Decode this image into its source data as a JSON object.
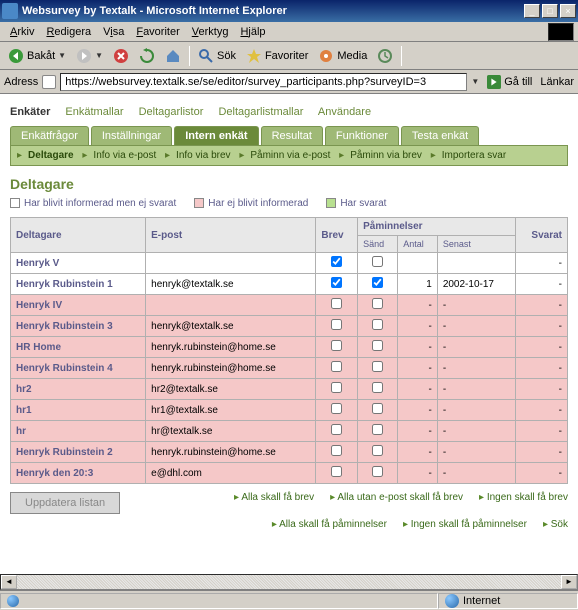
{
  "window": {
    "title": "Websurvey by Textalk - Microsoft Internet Explorer"
  },
  "menu": {
    "arkiv": "Arkiv",
    "redigera": "Redigera",
    "visa": "Visa",
    "favoriter": "Favoriter",
    "verktyg": "Verktyg",
    "hjalp": "Hjälp"
  },
  "toolbar": {
    "bakat": "Bakåt",
    "sok": "Sök",
    "favoriter": "Favoriter",
    "media": "Media"
  },
  "address": {
    "label": "Adress",
    "url": "https://websurvey.textalk.se/se/editor/survey_participants.php?surveyID=3",
    "go": "Gå till",
    "links": "Länkar"
  },
  "topnav": {
    "enkater": "Enkäter",
    "enkatmallar": "Enkätmallar",
    "deltagarlistor": "Deltagarlistor",
    "deltagarlistmallar": "Deltagarlistmallar",
    "anvandare": "Användare"
  },
  "tabs": {
    "enkatfragor": "Enkätfrågor",
    "installningar": "Inställningar",
    "intern": "Intern enkät",
    "resultat": "Resultat",
    "funktioner": "Funktioner",
    "testa": "Testa enkät"
  },
  "subnav": {
    "deltagare": "Deltagare",
    "info_epost": "Info via e-post",
    "info_brev": "Info via brev",
    "paminn_epost": "Påminn via e-post",
    "paminn_brev": "Påminn via brev",
    "importera": "Importera svar"
  },
  "section": {
    "title": "Deltagare"
  },
  "legend": {
    "informerad_ej_svarat": "Har blivit informerad men ej svarat",
    "ej_informerad": "Har ej blivit informerad",
    "har_svarat": "Har svarat"
  },
  "table": {
    "headers": {
      "deltagare": "Deltagare",
      "epost": "E-post",
      "brev": "Brev",
      "paminnelser": "Påminnelser",
      "sand": "Sänd",
      "antal": "Antal",
      "senast": "Senast",
      "svarat": "Svarat"
    },
    "rows": [
      {
        "name": "Henryk V",
        "email": "",
        "brev": true,
        "sand": false,
        "antal": "",
        "senast": "",
        "svarat": "-",
        "cls": "white"
      },
      {
        "name": "Henryk Rubinstein 1",
        "email": "henryk@textalk.se",
        "brev": true,
        "sand": true,
        "antal": "1",
        "senast": "2002-10-17",
        "svarat": "-",
        "cls": "white"
      },
      {
        "name": "Henryk IV",
        "email": "",
        "brev": false,
        "sand": false,
        "antal": "-",
        "senast": "-",
        "svarat": "-",
        "cls": "pink"
      },
      {
        "name": "Henryk Rubinstein 3",
        "email": "henryk@textalk.se",
        "brev": false,
        "sand": false,
        "antal": "-",
        "senast": "-",
        "svarat": "-",
        "cls": "pink"
      },
      {
        "name": "HR Home",
        "email": "henryk.rubinstein@home.se",
        "brev": false,
        "sand": false,
        "antal": "-",
        "senast": "-",
        "svarat": "-",
        "cls": "pink"
      },
      {
        "name": "Henryk Rubinstein 4",
        "email": "henryk.rubinstein@home.se",
        "brev": false,
        "sand": false,
        "antal": "-",
        "senast": "-",
        "svarat": "-",
        "cls": "pink"
      },
      {
        "name": "hr2",
        "email": "hr2@textalk.se",
        "brev": false,
        "sand": false,
        "antal": "-",
        "senast": "-",
        "svarat": "-",
        "cls": "pink"
      },
      {
        "name": "hr1",
        "email": "hr1@textalk.se",
        "brev": false,
        "sand": false,
        "antal": "-",
        "senast": "-",
        "svarat": "-",
        "cls": "pink"
      },
      {
        "name": "hr",
        "email": "hr@textalk.se",
        "brev": false,
        "sand": false,
        "antal": "-",
        "senast": "-",
        "svarat": "-",
        "cls": "pink"
      },
      {
        "name": "Henryk Rubinstein 2",
        "email": "henryk.rubinstein@home.se",
        "brev": false,
        "sand": false,
        "antal": "-",
        "senast": "-",
        "svarat": "-",
        "cls": "pink"
      },
      {
        "name": "Henryk den 20:3",
        "email": "e@dhl.com",
        "brev": false,
        "sand": false,
        "antal": "-",
        "senast": "-",
        "svarat": "-",
        "cls": "pink"
      }
    ]
  },
  "actions": {
    "alla_brev": "Alla skall få brev",
    "alla_utan_epost": "Alla utan e-post skall få brev",
    "ingen_brev": "Ingen skall få brev",
    "alla_paminn": "Alla skall få påminnelser",
    "ingen_paminn": "Ingen skall få påminnelser",
    "sok": "Sök",
    "uppdatera": "Uppdatera listan"
  },
  "status": {
    "zone": "Internet"
  }
}
